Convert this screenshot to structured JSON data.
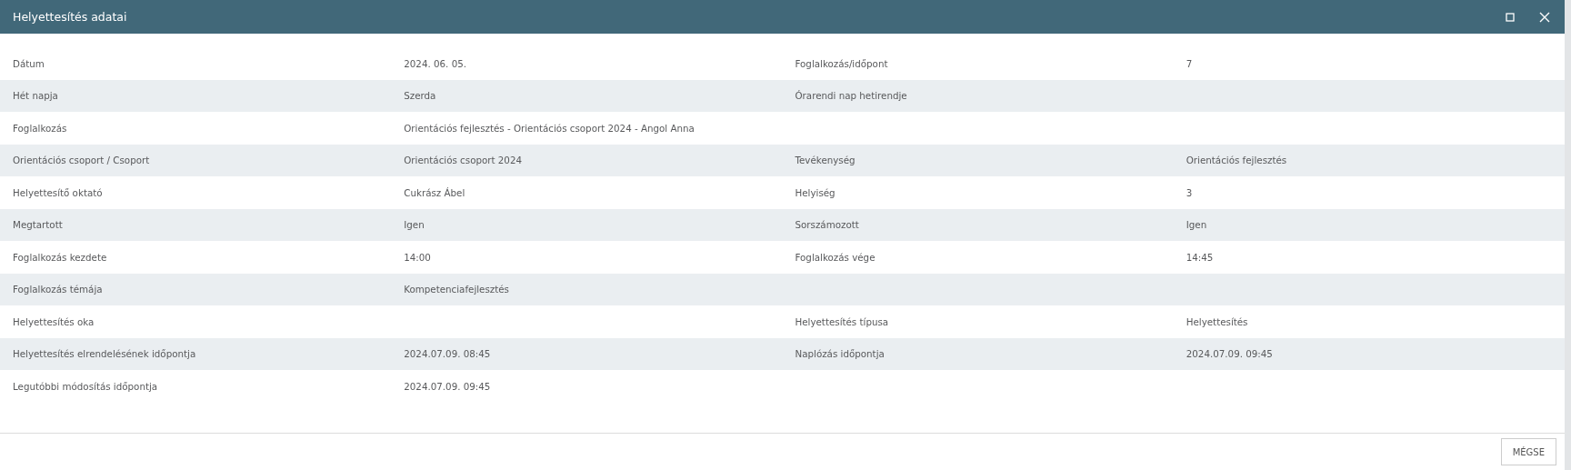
{
  "window": {
    "title": "Helyettesítés adatai"
  },
  "rows": [
    {
      "cells": [
        "Dátum",
        "2024. 06. 05.",
        "Foglalkozás/időpont",
        "7"
      ]
    },
    {
      "cells": [
        "Hét napja",
        "Szerda",
        "Órarendi nap hetirendje"
      ]
    },
    {
      "cells": [
        "Foglalkozás",
        "Orientációs fejlesztés - Orientációs csoport 2024 - Angol Anna"
      ]
    },
    {
      "cells": [
        "Orientációs csoport / Csoport",
        "Orientációs csoport 2024",
        "Tevékenység",
        "Orientációs fejlesztés"
      ]
    },
    {
      "cells": [
        "Helyettesítő oktató",
        "Cukrász Ábel",
        "Helyiség",
        "3"
      ]
    },
    {
      "cells": [
        "Megtartott",
        "Igen",
        "Sorszámozott",
        "Igen"
      ]
    },
    {
      "cells": [
        "Foglalkozás kezdete",
        "14:00",
        "Foglalkozás vége",
        "14:45"
      ]
    },
    {
      "cells": [
        "Foglalkozás témája",
        "Kompetenciafejlesztés"
      ]
    },
    {
      "cells": [
        "Helyettesítés oka",
        "",
        "Helyettesítés típusa",
        "Helyettesítés"
      ]
    },
    {
      "cells": [
        "Helyettesítés elrendelésének időpontja",
        "2024.07.09. 08:45",
        "Naplózás időpontja",
        "2024.07.09. 09:45"
      ]
    },
    {
      "cells": [
        "Legutóbbi módosítás időpontja",
        "2024.07.09. 09:45"
      ]
    }
  ],
  "footer": {
    "buttons": [
      "MÉGSE"
    ]
  }
}
